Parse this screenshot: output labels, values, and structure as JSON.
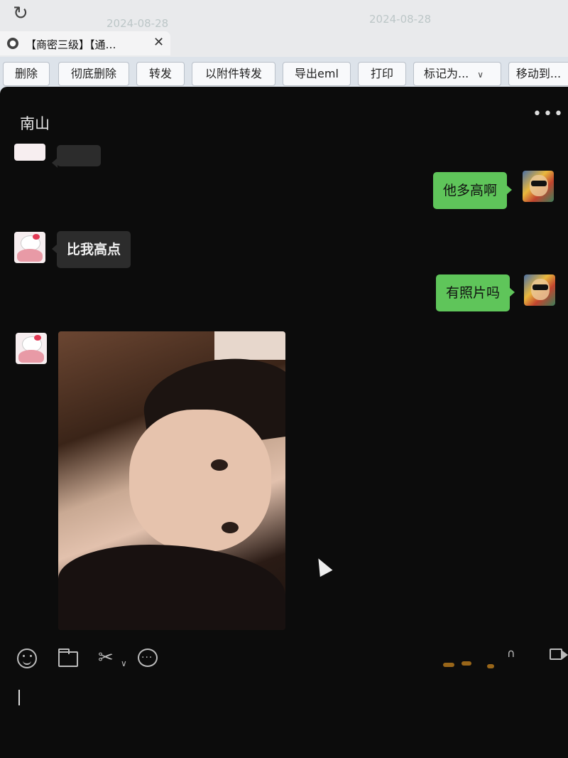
{
  "browser": {
    "tab_title": "【商密三级】【通…",
    "watermarks": [
      "2024-08-28",
      "2024-08-28"
    ],
    "icons": [
      "reload-icon",
      "globe-icon",
      "close-icon"
    ]
  },
  "toolbar": {
    "buttons": [
      "删除",
      "彻底删除",
      "转发",
      "以附件转发",
      "导出eml",
      "打印",
      "标记为...",
      "移动到..."
    ]
  },
  "chat": {
    "contact_name": "南山",
    "more_label": "•••",
    "messages": [
      {
        "side": "out",
        "text": "他多高啊"
      },
      {
        "side": "in",
        "text": "比我高点"
      },
      {
        "side": "out",
        "text": "有照片吗"
      },
      {
        "side": "in",
        "type": "image"
      }
    ]
  },
  "input_bar": {
    "icons": [
      "emoji-icon",
      "folder-icon",
      "scissors-icon",
      "chat-history-icon",
      "phone-icon",
      "video-call-icon"
    ]
  },
  "colors": {
    "outgoing_bubble": "#5fc55a",
    "incoming_bubble": "#2c2c2c",
    "chat_background": "#0c0c0c",
    "mail_toolbar": "#dde3ea"
  }
}
